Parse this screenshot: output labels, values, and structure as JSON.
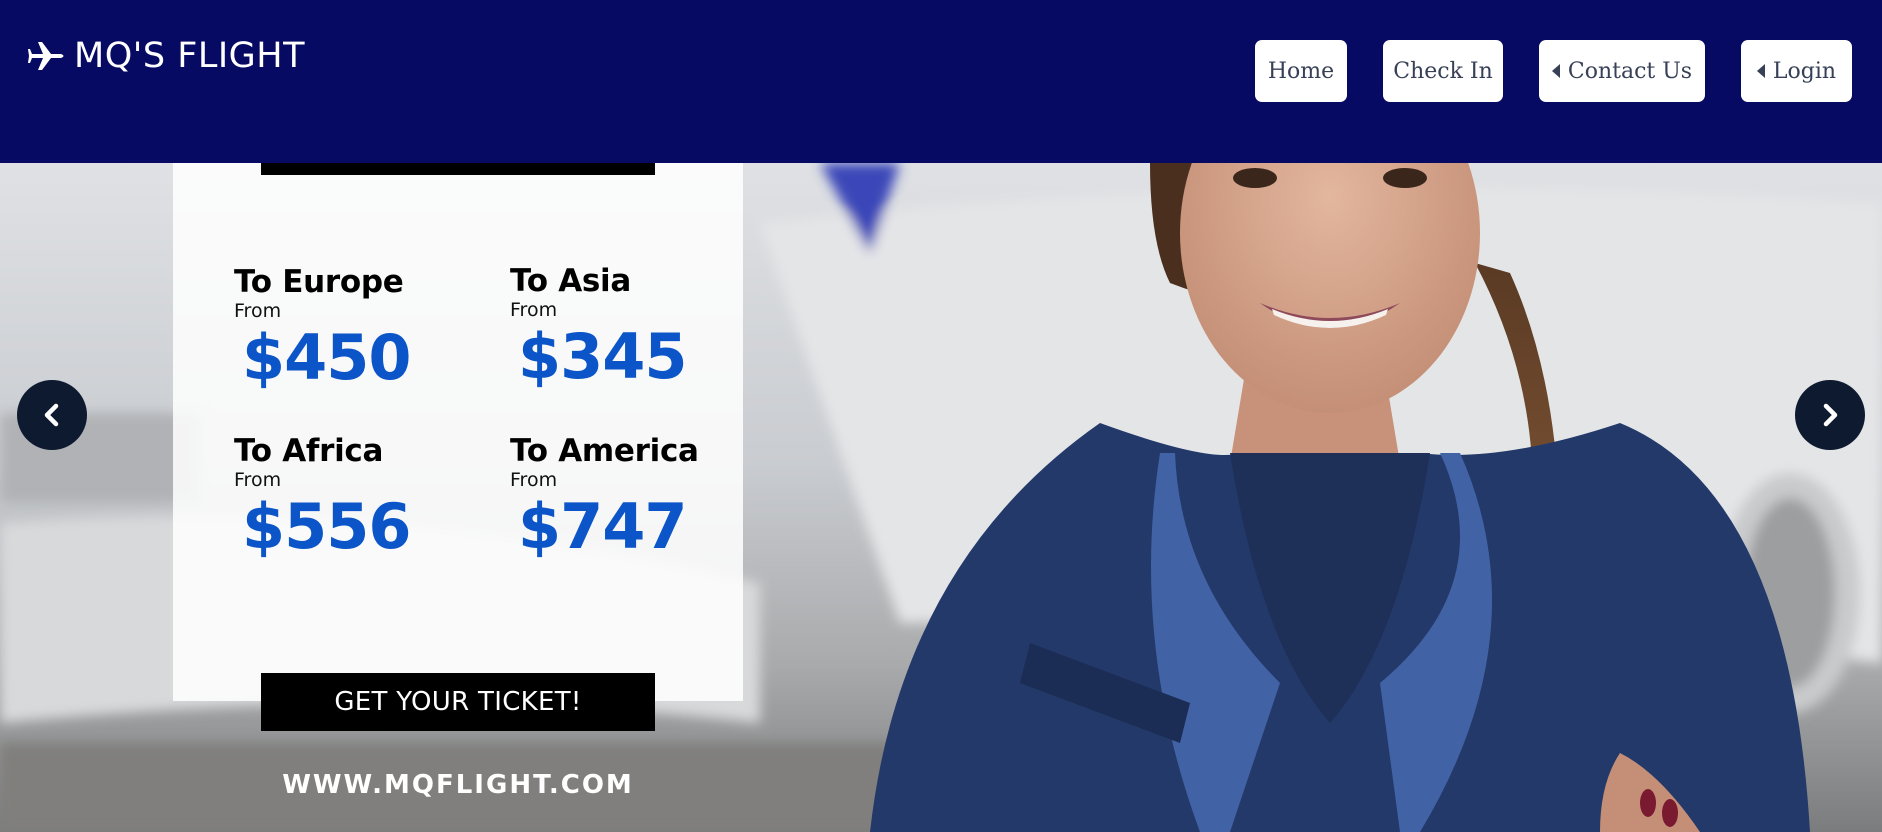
{
  "brand": {
    "name": "MQ'S FLIGHT",
    "icon": "airplane-icon"
  },
  "nav": {
    "home": "Home",
    "check_in": "Check In",
    "contact": "Contact Us",
    "login": "Login"
  },
  "promo": {
    "destinations": [
      {
        "name": "To Europe",
        "from": "From",
        "price": "$450"
      },
      {
        "name": "To Asia",
        "from": "From",
        "price": "$345"
      },
      {
        "name": "To Africa",
        "from": "From",
        "price": "$556"
      },
      {
        "name": "To America",
        "from": "From",
        "price": "$747"
      }
    ],
    "cta": "GET YOUR TICKET!",
    "website": "WWW.MQFLIGHT.COM"
  },
  "carousel": {
    "prev_icon": "chevron-left-icon",
    "next_icon": "chevron-right-icon"
  },
  "colors": {
    "header": "#060a63",
    "price": "#0b55c8",
    "arrow": "#0e1a30"
  }
}
